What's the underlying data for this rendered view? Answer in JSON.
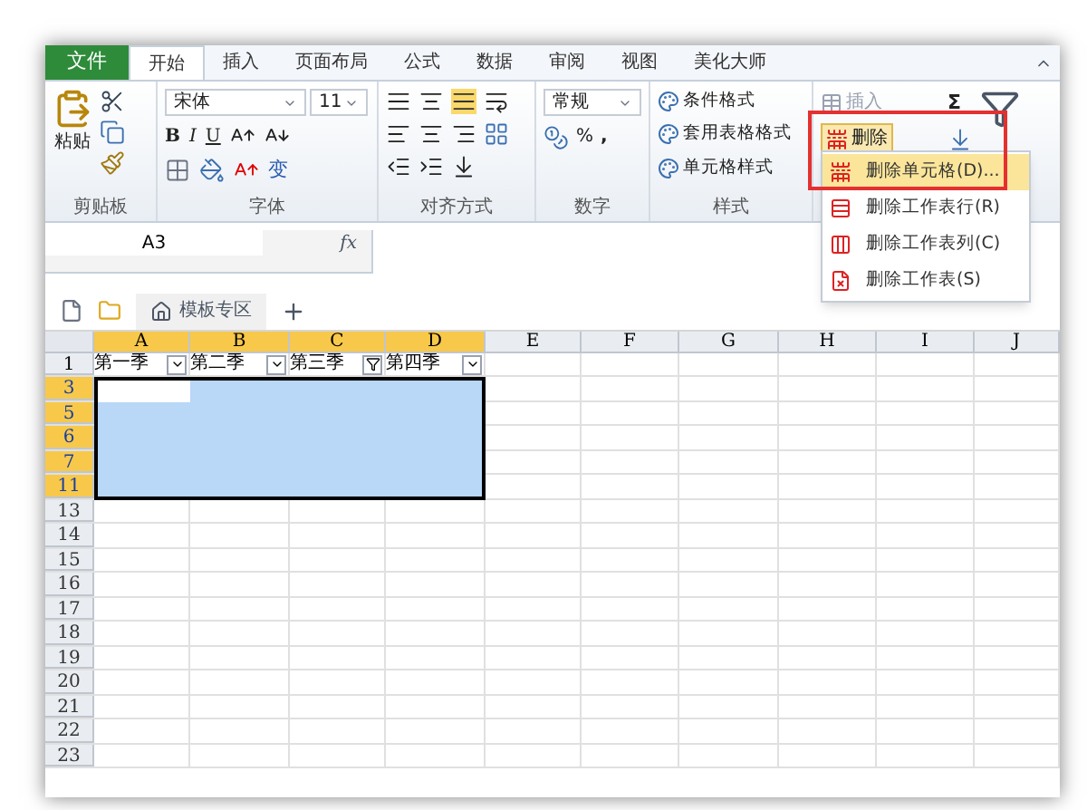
{
  "ribbon_tabs": [
    {
      "label": "文件",
      "kind": "file",
      "selected": false
    },
    {
      "label": "开始",
      "kind": "tab",
      "selected": true
    },
    {
      "label": "插入",
      "kind": "tab",
      "selected": false
    },
    {
      "label": "页面布局",
      "kind": "tab",
      "selected": false
    },
    {
      "label": "公式",
      "kind": "tab",
      "selected": false
    },
    {
      "label": "数据",
      "kind": "tab",
      "selected": false
    },
    {
      "label": "审阅",
      "kind": "tab",
      "selected": false
    },
    {
      "label": "视图",
      "kind": "tab",
      "selected": false
    },
    {
      "label": "美化大师",
      "kind": "tab",
      "selected": false
    }
  ],
  "clipboard": {
    "paste": "粘贴",
    "group": "剪贴板"
  },
  "font": {
    "name": "宋体",
    "size": "11",
    "bold": "B",
    "italic": "I",
    "underline": "U",
    "phonetic": "变",
    "group": "字体"
  },
  "alignment": {
    "group": "对齐方式"
  },
  "number": {
    "format": "常规",
    "percent": "%",
    "comma": ",",
    "group": "数字"
  },
  "styles": {
    "items": [
      "条件格式",
      "套用表格格式",
      "单元格样式"
    ],
    "group": "样式"
  },
  "cells": {
    "insert": "插入",
    "delete": "删除"
  },
  "editing": {
    "sum": "Σ"
  },
  "delete_menu": [
    {
      "label": "删除单元格(D)...",
      "selected": true
    },
    {
      "label": "删除工作表行(R)",
      "selected": false
    },
    {
      "label": "删除工作表列(C)",
      "selected": false
    },
    {
      "label": "删除工作表(S)",
      "selected": false
    }
  ],
  "formula_bar": {
    "name_box": "A3",
    "fx": "fx"
  },
  "doc_tabs": [
    {
      "label": "模板专区"
    }
  ],
  "sheet": {
    "columns": [
      {
        "label": "A",
        "selected": true,
        "active": true
      },
      {
        "label": "B",
        "selected": true,
        "active": false
      },
      {
        "label": "C",
        "selected": true,
        "active": false
      },
      {
        "label": "D",
        "selected": true,
        "active": false
      },
      {
        "label": "E",
        "selected": false,
        "active": false
      },
      {
        "label": "F",
        "selected": false,
        "active": false
      },
      {
        "label": "G",
        "selected": false,
        "active": false
      },
      {
        "label": "H",
        "selected": false,
        "active": false
      },
      {
        "label": "I",
        "selected": false,
        "active": false
      },
      {
        "label": "J",
        "selected": false,
        "active": false
      }
    ],
    "header_row": {
      "label": "1",
      "cells": [
        {
          "text": "第一季",
          "filtered": false
        },
        {
          "text": "第二季",
          "filtered": false
        },
        {
          "text": "第三季",
          "filtered": true
        },
        {
          "text": "第四季",
          "filtered": false
        }
      ]
    },
    "rows": [
      {
        "label": "3",
        "selected": true,
        "active": true
      },
      {
        "label": "5",
        "selected": true,
        "active": false
      },
      {
        "label": "6",
        "selected": true,
        "active": false
      },
      {
        "label": "7",
        "selected": true,
        "active": false
      },
      {
        "label": "11",
        "selected": true,
        "active": false
      },
      {
        "label": "13",
        "selected": false,
        "active": false
      },
      {
        "label": "14",
        "selected": false,
        "active": false
      },
      {
        "label": "15",
        "selected": false,
        "active": false
      },
      {
        "label": "16",
        "selected": false,
        "active": false
      },
      {
        "label": "17",
        "selected": false,
        "active": false
      },
      {
        "label": "18",
        "selected": false,
        "active": false
      },
      {
        "label": "19",
        "selected": false,
        "active": false
      },
      {
        "label": "20",
        "selected": false,
        "active": false
      },
      {
        "label": "21",
        "selected": false,
        "active": false
      },
      {
        "label": "22",
        "selected": false,
        "active": false
      },
      {
        "label": "23",
        "selected": false,
        "active": false
      }
    ]
  }
}
